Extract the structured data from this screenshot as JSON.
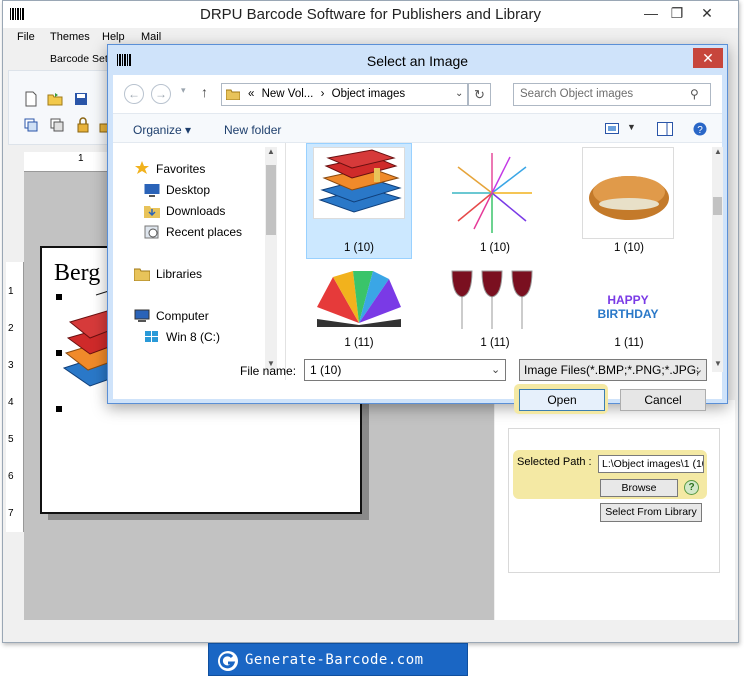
{
  "app": {
    "title": "DRPU Barcode Software for Publishers and Library",
    "menu": [
      "File",
      "Themes",
      "Help",
      "Mail"
    ],
    "toolbar_tab": "Barcode Set",
    "ruler_top_mark": "1",
    "ruler_left_marks": [
      "1",
      "2",
      "3",
      "4",
      "5",
      "6",
      "7"
    ],
    "label_text": "Berg"
  },
  "dialog": {
    "title": "Select an Image",
    "close": "✕",
    "address": {
      "prefix": "«",
      "parent": "New Vol...",
      "separator": "›",
      "current": "Object images"
    },
    "search_placeholder": "Search Object images",
    "organize": "Organize ▾",
    "new_folder": "New folder",
    "nav": {
      "favorites": "Favorites",
      "desktop": "Desktop",
      "downloads": "Downloads",
      "recent": "Recent places",
      "libraries": "Libraries",
      "computer": "Computer",
      "win8": "Win 8 (C:)"
    },
    "files": [
      {
        "label": "1 (10)",
        "icon": "books-stack-icon",
        "selected": true
      },
      {
        "label": "1 (10)",
        "icon": "fireworks-icon",
        "selected": false
      },
      {
        "label": "1 (10)",
        "icon": "croissant-sandwich-icon",
        "selected": false
      },
      {
        "label": "1 (11)",
        "icon": "rainbow-book-icon",
        "selected": false
      },
      {
        "label": "1 (11)",
        "icon": "wine-glasses-icon",
        "selected": false
      },
      {
        "label": "1 (11)",
        "icon": "happy-birthday-icon",
        "selected": false
      }
    ],
    "birthday_text": [
      "HAPPY",
      "BIRTHDAY"
    ],
    "file_name_label": "File name:",
    "file_name_value": "1 (10)",
    "file_type_value": "Image Files(*.BMP;*.PNG;*.JPG;",
    "open_label": "Open",
    "cancel_label": "Cancel"
  },
  "panel": {
    "selected_path_label": "Selected Path :",
    "selected_path_value": "L:\\Object images\\1 (10",
    "browse_label": "Browse",
    "help": "?",
    "select_library_label": "Select From Library"
  },
  "footer": {
    "text": "Generate-Barcode.com"
  },
  "colors": {
    "dialog_bg": "#cfe3fa",
    "selection": "#cce8ff",
    "highlight": "#f4e9a4",
    "close_red": "#c7463c",
    "footer_blue": "#1a66c4"
  }
}
